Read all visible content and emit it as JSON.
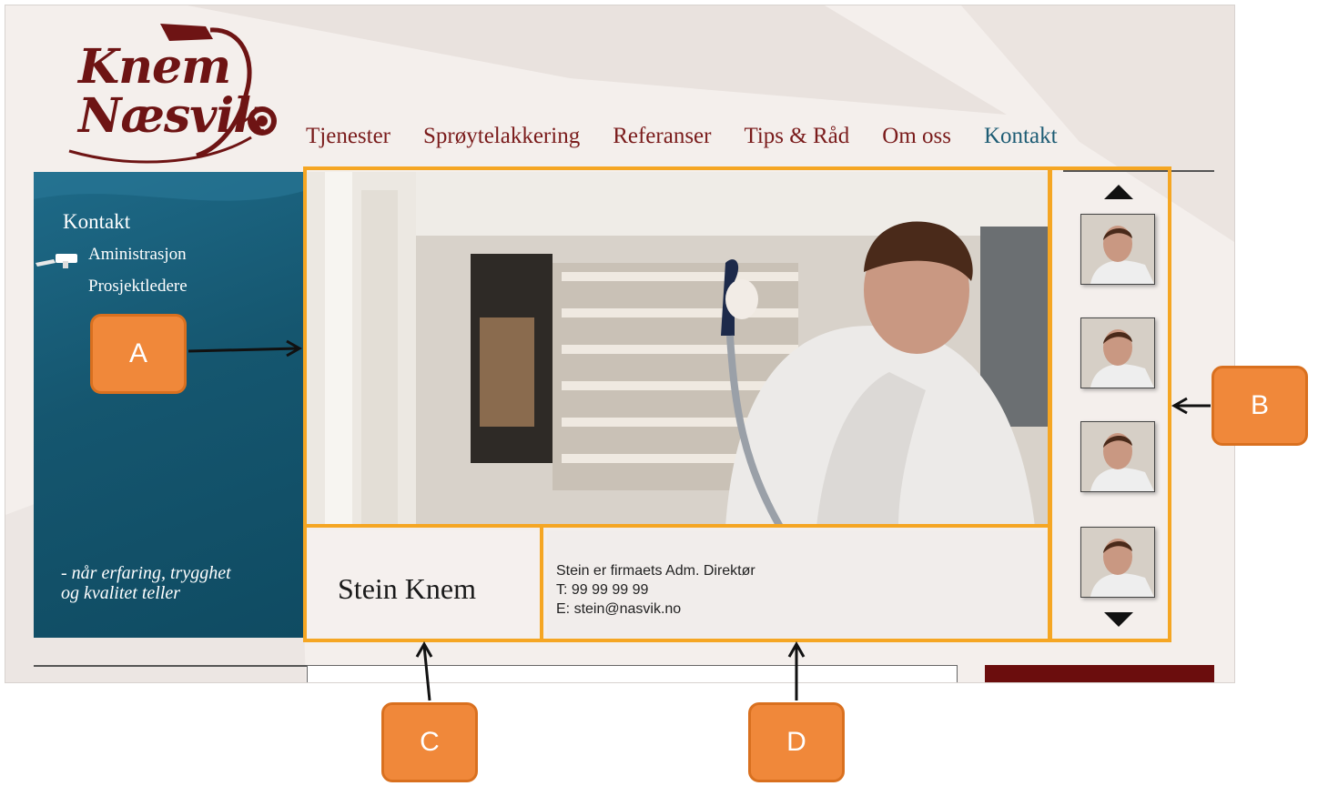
{
  "nav": {
    "items": [
      "Tjenester",
      "Sprøytelakkering",
      "Referanser",
      "Tips & Råd",
      "Om oss",
      "Kontakt"
    ],
    "active": "Kontakt"
  },
  "logo": {
    "line1": "Knem",
    "line2": "Næsvik"
  },
  "sidebar": {
    "title": "Kontakt",
    "items": [
      {
        "label": "Aministrasjon",
        "icon": "spray-gun-icon"
      },
      {
        "label": "Prosjektledere"
      }
    ],
    "tagline_1": "- når erfaring, trygghet",
    "tagline_2": "og kvalitet teller"
  },
  "profile": {
    "name": "Stein Knem",
    "info": [
      "Stein er firmaets Adm. Direktør",
      "T: 99 99 99 99",
      "E: stein@nasvik.no"
    ]
  },
  "thumbnails": {
    "count": 4,
    "up_icon": "triangle-up-icon",
    "down_icon": "triangle-down-icon"
  },
  "annotations": {
    "labels": [
      "A",
      "B",
      "C",
      "D"
    ],
    "color": "#f5a623",
    "callout_color": "#f0883a"
  },
  "colors": {
    "brand_red": "#6e1414",
    "panel_blue": "#15566f",
    "active_nav": "#1d5c74"
  }
}
